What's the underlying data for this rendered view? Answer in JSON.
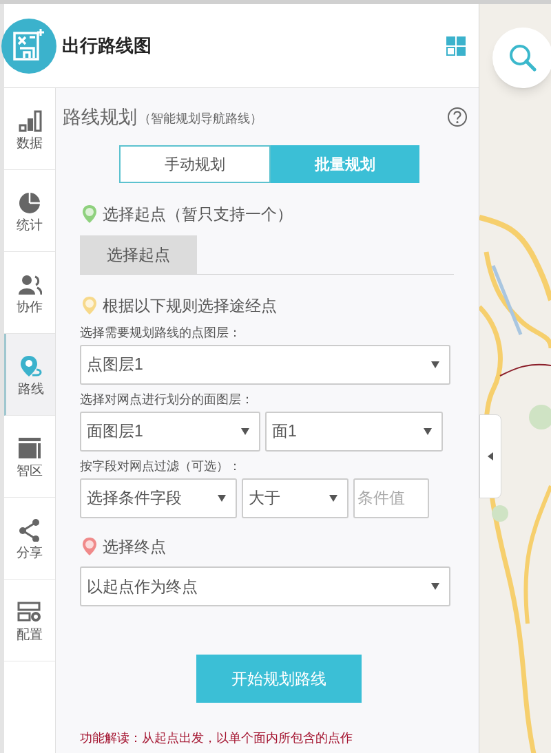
{
  "app": {
    "title": "出行路线图"
  },
  "nav": [
    {
      "label": "数据",
      "selected": false
    },
    {
      "label": "统计",
      "selected": false
    },
    {
      "label": "协作",
      "selected": false
    },
    {
      "label": "路线",
      "selected": true
    },
    {
      "label": "智区",
      "selected": false
    },
    {
      "label": "分享",
      "selected": false
    },
    {
      "label": "配置",
      "selected": false
    }
  ],
  "panel": {
    "title": "路线规划",
    "subtitle": "（智能规划导航路线）",
    "tabs": [
      {
        "label": "手动规划",
        "selected": false
      },
      {
        "label": "批量规划",
        "selected": true
      }
    ],
    "start": {
      "heading": "选择起点（暂只支持一个）",
      "button": "选择起点"
    },
    "waypoints": {
      "heading": "根据以下规则选择途经点",
      "point_layer_label": "选择需要规划路线的点图层：",
      "point_layer": "点图层1",
      "area_layer_label": "选择对网点进行划分的面图层：",
      "area_layer": "面图层1",
      "area": "面1",
      "filter_label": "按字段对网点过滤（可选）：",
      "filter_field": "选择条件字段",
      "filter_op": "大于",
      "filter_value_placeholder": "条件值"
    },
    "end": {
      "heading": "选择终点",
      "value": "以起点作为终点"
    },
    "submit": "开始规划路线",
    "note": "功能解读：从起点出发，以单个面内所包含的点作"
  }
}
